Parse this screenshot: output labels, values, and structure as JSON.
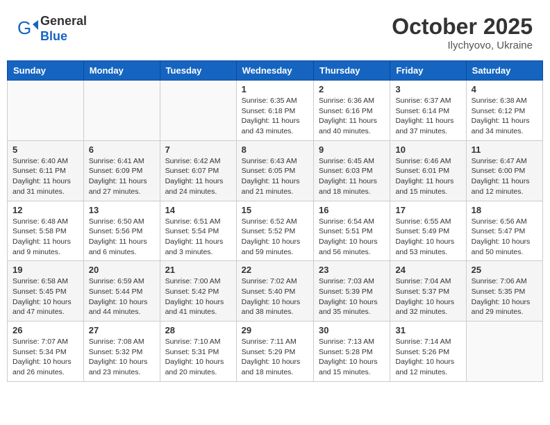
{
  "header": {
    "logo_line1": "General",
    "logo_line2": "Blue",
    "month": "October 2025",
    "location": "Ilychyovo, Ukraine"
  },
  "weekdays": [
    "Sunday",
    "Monday",
    "Tuesday",
    "Wednesday",
    "Thursday",
    "Friday",
    "Saturday"
  ],
  "weeks": [
    [
      {
        "day": "",
        "info": ""
      },
      {
        "day": "",
        "info": ""
      },
      {
        "day": "",
        "info": ""
      },
      {
        "day": "1",
        "info": "Sunrise: 6:35 AM\nSunset: 6:18 PM\nDaylight: 11 hours\nand 43 minutes."
      },
      {
        "day": "2",
        "info": "Sunrise: 6:36 AM\nSunset: 6:16 PM\nDaylight: 11 hours\nand 40 minutes."
      },
      {
        "day": "3",
        "info": "Sunrise: 6:37 AM\nSunset: 6:14 PM\nDaylight: 11 hours\nand 37 minutes."
      },
      {
        "day": "4",
        "info": "Sunrise: 6:38 AM\nSunset: 6:12 PM\nDaylight: 11 hours\nand 34 minutes."
      }
    ],
    [
      {
        "day": "5",
        "info": "Sunrise: 6:40 AM\nSunset: 6:11 PM\nDaylight: 11 hours\nand 31 minutes."
      },
      {
        "day": "6",
        "info": "Sunrise: 6:41 AM\nSunset: 6:09 PM\nDaylight: 11 hours\nand 27 minutes."
      },
      {
        "day": "7",
        "info": "Sunrise: 6:42 AM\nSunset: 6:07 PM\nDaylight: 11 hours\nand 24 minutes."
      },
      {
        "day": "8",
        "info": "Sunrise: 6:43 AM\nSunset: 6:05 PM\nDaylight: 11 hours\nand 21 minutes."
      },
      {
        "day": "9",
        "info": "Sunrise: 6:45 AM\nSunset: 6:03 PM\nDaylight: 11 hours\nand 18 minutes."
      },
      {
        "day": "10",
        "info": "Sunrise: 6:46 AM\nSunset: 6:01 PM\nDaylight: 11 hours\nand 15 minutes."
      },
      {
        "day": "11",
        "info": "Sunrise: 6:47 AM\nSunset: 6:00 PM\nDaylight: 11 hours\nand 12 minutes."
      }
    ],
    [
      {
        "day": "12",
        "info": "Sunrise: 6:48 AM\nSunset: 5:58 PM\nDaylight: 11 hours\nand 9 minutes."
      },
      {
        "day": "13",
        "info": "Sunrise: 6:50 AM\nSunset: 5:56 PM\nDaylight: 11 hours\nand 6 minutes."
      },
      {
        "day": "14",
        "info": "Sunrise: 6:51 AM\nSunset: 5:54 PM\nDaylight: 11 hours\nand 3 minutes."
      },
      {
        "day": "15",
        "info": "Sunrise: 6:52 AM\nSunset: 5:52 PM\nDaylight: 10 hours\nand 59 minutes."
      },
      {
        "day": "16",
        "info": "Sunrise: 6:54 AM\nSunset: 5:51 PM\nDaylight: 10 hours\nand 56 minutes."
      },
      {
        "day": "17",
        "info": "Sunrise: 6:55 AM\nSunset: 5:49 PM\nDaylight: 10 hours\nand 53 minutes."
      },
      {
        "day": "18",
        "info": "Sunrise: 6:56 AM\nSunset: 5:47 PM\nDaylight: 10 hours\nand 50 minutes."
      }
    ],
    [
      {
        "day": "19",
        "info": "Sunrise: 6:58 AM\nSunset: 5:45 PM\nDaylight: 10 hours\nand 47 minutes."
      },
      {
        "day": "20",
        "info": "Sunrise: 6:59 AM\nSunset: 5:44 PM\nDaylight: 10 hours\nand 44 minutes."
      },
      {
        "day": "21",
        "info": "Sunrise: 7:00 AM\nSunset: 5:42 PM\nDaylight: 10 hours\nand 41 minutes."
      },
      {
        "day": "22",
        "info": "Sunrise: 7:02 AM\nSunset: 5:40 PM\nDaylight: 10 hours\nand 38 minutes."
      },
      {
        "day": "23",
        "info": "Sunrise: 7:03 AM\nSunset: 5:39 PM\nDaylight: 10 hours\nand 35 minutes."
      },
      {
        "day": "24",
        "info": "Sunrise: 7:04 AM\nSunset: 5:37 PM\nDaylight: 10 hours\nand 32 minutes."
      },
      {
        "day": "25",
        "info": "Sunrise: 7:06 AM\nSunset: 5:35 PM\nDaylight: 10 hours\nand 29 minutes."
      }
    ],
    [
      {
        "day": "26",
        "info": "Sunrise: 7:07 AM\nSunset: 5:34 PM\nDaylight: 10 hours\nand 26 minutes."
      },
      {
        "day": "27",
        "info": "Sunrise: 7:08 AM\nSunset: 5:32 PM\nDaylight: 10 hours\nand 23 minutes."
      },
      {
        "day": "28",
        "info": "Sunrise: 7:10 AM\nSunset: 5:31 PM\nDaylight: 10 hours\nand 20 minutes."
      },
      {
        "day": "29",
        "info": "Sunrise: 7:11 AM\nSunset: 5:29 PM\nDaylight: 10 hours\nand 18 minutes."
      },
      {
        "day": "30",
        "info": "Sunrise: 7:13 AM\nSunset: 5:28 PM\nDaylight: 10 hours\nand 15 minutes."
      },
      {
        "day": "31",
        "info": "Sunrise: 7:14 AM\nSunset: 5:26 PM\nDaylight: 10 hours\nand 12 minutes."
      },
      {
        "day": "",
        "info": ""
      }
    ]
  ]
}
